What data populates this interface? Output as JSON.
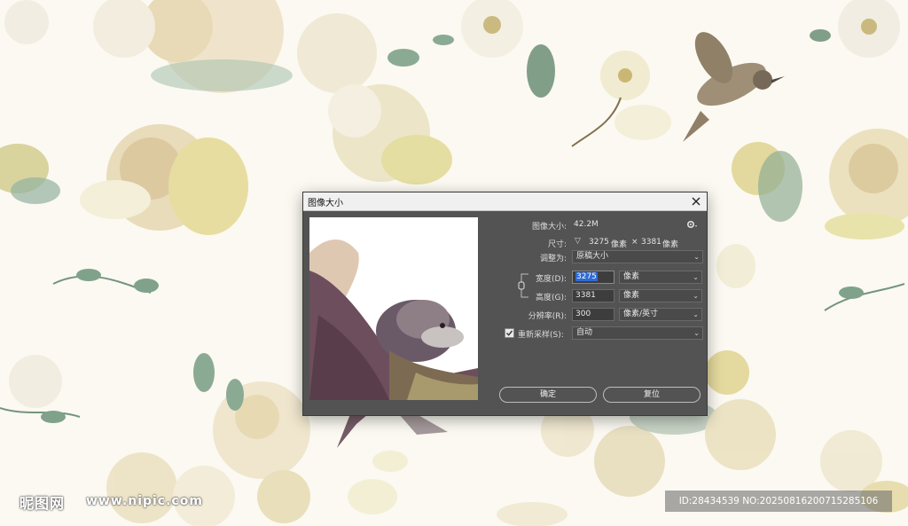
{
  "dialog": {
    "title": "图像大小",
    "image_size_label": "图像大小:",
    "image_size_value": "42.2M",
    "dimensions_label": "尺寸:",
    "dimensions_width": "3275",
    "dimensions_unit1": "像素",
    "dimensions_times": "×",
    "dimensions_height": "3381",
    "dimensions_unit2": "像素",
    "fit_to_label": "调整为:",
    "fit_to_value": "原稿大小",
    "width_label": "宽度(D):",
    "width_value": "3275",
    "width_unit": "像素",
    "height_label": "高度(G):",
    "height_value": "3381",
    "height_unit": "像素",
    "resolution_label": "分辨率(R):",
    "resolution_value": "300",
    "resolution_unit": "像素/英寸",
    "resample_label": "重新采样(S):",
    "resample_value": "自动",
    "ok_label": "确定",
    "reset_label": "复位"
  },
  "watermark": {
    "logo": "昵图网",
    "url": "www.nipic.com",
    "id_text": "ID:28434539 NO:20250816200715285106"
  },
  "colors": {
    "dialog_bg": "#535353",
    "title_bg": "#f0f0f0",
    "selection": "#2e6bd6"
  }
}
